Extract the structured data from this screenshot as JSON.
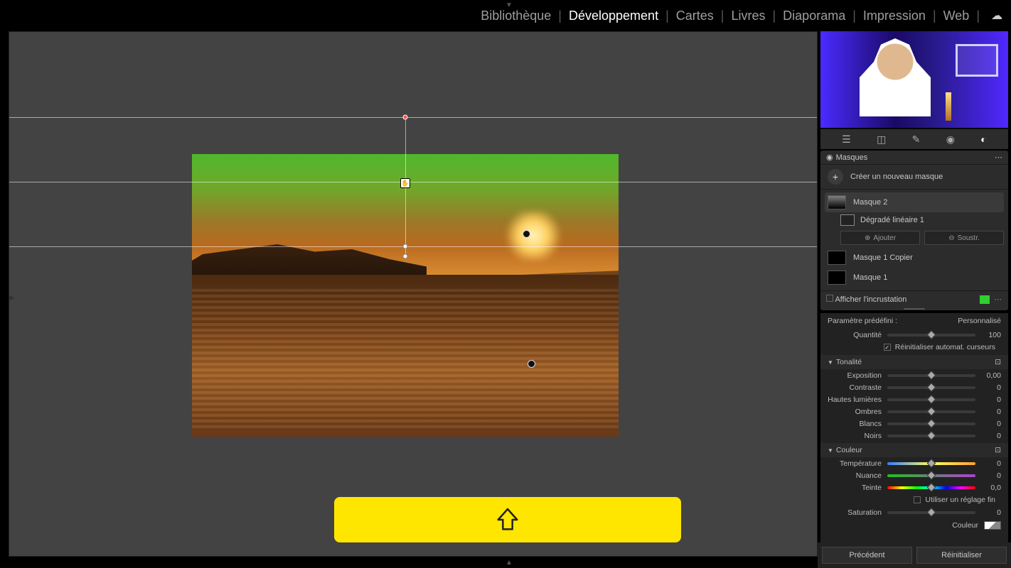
{
  "tabs": {
    "bibliotheque": "Bibliothèque",
    "developpement": "Développement",
    "cartes": "Cartes",
    "livres": "Livres",
    "diaporama": "Diaporama",
    "impression": "Impression",
    "web": "Web"
  },
  "masks": {
    "panel_title": "Masques",
    "create_new": "Créer un nouveau masque",
    "items": [
      {
        "name": "Masque 2",
        "active": true,
        "sub": {
          "name": "Dégradé linéaire 1"
        }
      },
      {
        "name": "Masque 1 Copier"
      },
      {
        "name": "Masque 1"
      }
    ],
    "add": "Ajouter",
    "subtract": "Soustr.",
    "show_overlay": "Afficher l'incrustation",
    "overlay_color": "#2fcf2f"
  },
  "preset": {
    "label": "Paramètre prédéfini :",
    "value": "Personnalisé",
    "amount_label": "Quantité",
    "amount_value": "100",
    "auto_reset": "Réinitialiser automat. curseurs"
  },
  "tone": {
    "section": "Tonalité",
    "exposure": {
      "label": "Exposition",
      "value": "0,00"
    },
    "contrast": {
      "label": "Contraste",
      "value": "0"
    },
    "highlights": {
      "label": "Hautes lumières",
      "value": "0"
    },
    "shadows": {
      "label": "Ombres",
      "value": "0"
    },
    "whites": {
      "label": "Blancs",
      "value": "0"
    },
    "blacks": {
      "label": "Noirs",
      "value": "0"
    }
  },
  "color": {
    "section": "Couleur",
    "temperature": {
      "label": "Température",
      "value": "0"
    },
    "tint": {
      "label": "Nuance",
      "value": "0"
    },
    "hue": {
      "label": "Teinte",
      "value": "0,0"
    },
    "fine": "Utiliser un réglage fin",
    "saturation": {
      "label": "Saturation",
      "value": "0"
    },
    "color_label": "Couleur"
  },
  "footer": {
    "prev": "Précédent",
    "reset": "Réinitialiser"
  }
}
